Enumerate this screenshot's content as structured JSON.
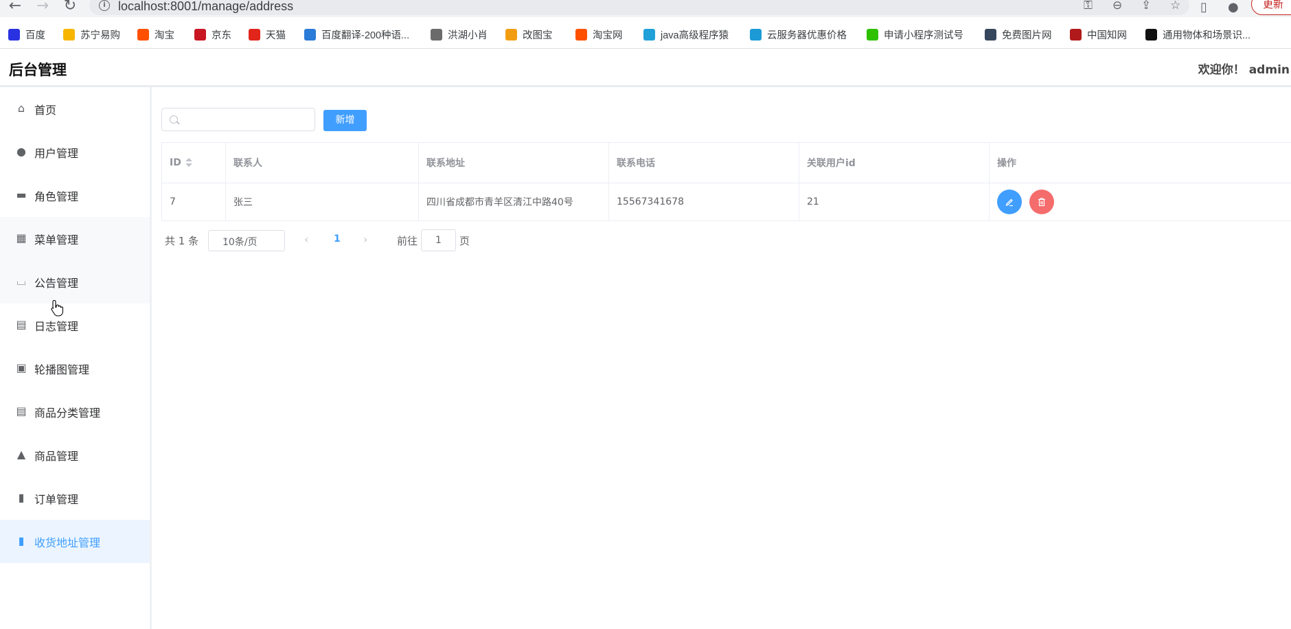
{
  "browser": {
    "url": "localhost:8001/manage/address",
    "update_label": "更新",
    "bookmarks": [
      {
        "label": "百度",
        "icon": "baidu-icon",
        "color": "#2932e1"
      },
      {
        "label": "苏宁易购",
        "icon": "suning-icon",
        "color": "#f7b500"
      },
      {
        "label": "淘宝",
        "icon": "taobao-icon",
        "color": "#ff5000"
      },
      {
        "label": "京东",
        "icon": "jd-icon",
        "color": "#c91623"
      },
      {
        "label": "天猫",
        "icon": "tmall-icon",
        "color": "#e1251b"
      },
      {
        "label": "百度翻译-200种语...",
        "icon": "translate-icon",
        "color": "#2b7bd8"
      },
      {
        "label": "洪湖小肖",
        "icon": "hawk-icon",
        "color": "#6b6b6b"
      },
      {
        "label": "改图宝",
        "icon": "gaitubao-icon",
        "color": "#f29d11"
      },
      {
        "label": "淘宝网",
        "icon": "taobao-icon",
        "color": "#ff5000"
      },
      {
        "label": "java高级程序猿",
        "icon": "bilibili-icon",
        "color": "#20a0d8"
      },
      {
        "label": "云服务器优惠价格",
        "icon": "cloud-icon",
        "color": "#1c9ad6"
      },
      {
        "label": "申请小程序测试号",
        "icon": "wechat-icon",
        "color": "#2ec100"
      },
      {
        "label": "免费图片网",
        "icon": "tumblr-icon",
        "color": "#36465d"
      },
      {
        "label": "中国知网",
        "icon": "cnki-icon",
        "color": "#b11a1a"
      },
      {
        "label": "通用物体和场景识...",
        "icon": "ai-icon",
        "color": "#111111"
      }
    ]
  },
  "header": {
    "title": "后台管理",
    "welcome": "欢迎你！ admin"
  },
  "sidebar": {
    "items": [
      {
        "label": "首页",
        "icon": "home-icon"
      },
      {
        "label": "用户管理",
        "icon": "user-icon"
      },
      {
        "label": "角色管理",
        "icon": "briefcase-icon"
      },
      {
        "label": "菜单管理",
        "icon": "grid-icon"
      },
      {
        "label": "公告管理",
        "icon": "easel-icon"
      },
      {
        "label": "日志管理",
        "icon": "notebook-icon"
      },
      {
        "label": "轮播图管理",
        "icon": "picture-icon"
      },
      {
        "label": "商品分类管理",
        "icon": "document-icon"
      },
      {
        "label": "商品管理",
        "icon": "bag-icon"
      },
      {
        "label": "订单管理",
        "icon": "bar-chart-icon"
      },
      {
        "label": "收货地址管理",
        "icon": "bar-chart-icon"
      }
    ],
    "active_index": 10
  },
  "toolbar": {
    "search_placeholder": "",
    "add_label": "新增"
  },
  "table": {
    "columns": [
      "ID",
      "联系人",
      "联系地址",
      "联系电话",
      "关联用户id",
      "操作"
    ],
    "rows": [
      {
        "id": "7",
        "contact": "张三",
        "address": "四川省成都市青羊区清江中路40号",
        "phone": "15567341678",
        "user_id": "21"
      }
    ]
  },
  "pagination": {
    "total_text": "共 1 条",
    "page_size": "10条/页",
    "current_page": "1",
    "goto_label": "前往",
    "goto_value": "1",
    "page_suffix": "页"
  },
  "colors": {
    "primary": "#409eff",
    "danger": "#f56c6c"
  }
}
